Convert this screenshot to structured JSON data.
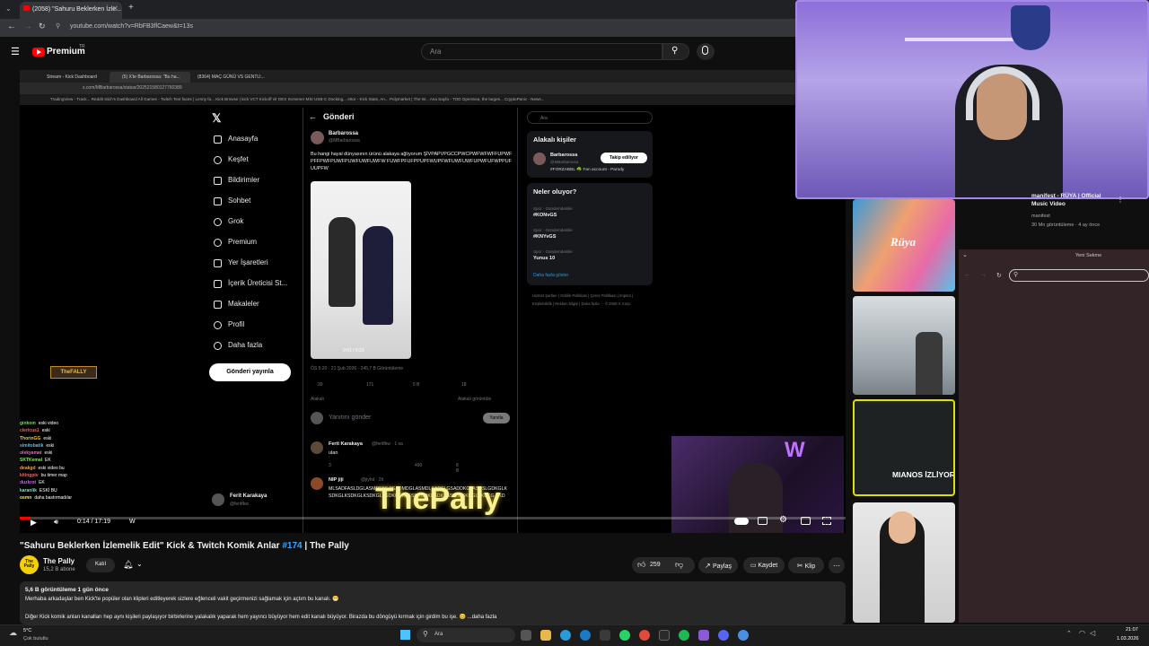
{
  "browser": {
    "tab_title": "(2058) \"Sahuru Beklerken İzle...",
    "url": "youtube.com/watch?v=RbFB3flCaew&t=13s"
  },
  "youtube": {
    "brand": "Premium",
    "region": "TR",
    "search_placeholder": "Ara"
  },
  "inner_browser": {
    "tabs": [
      "Stream - Kick Dashboard",
      "(5) X'te Barbarossa: \"Bu ha...",
      "(8364) MAÇ GÜNÜ VS GENTLI..."
    ],
    "url": "x.com/MBarbarossa/status/202521580127760389",
    "bookmarks": "TradingView - Track...   Reddit   stich's Dashboard   All Games - Twitch   Text faces | Lenny fa...   Kick   Browse | kick   VCT Kickoff   vlr   DEX Screener   MSI USB-C Docking...   ettor - Kick Stats, An...   Polymarket | The W...   Ana Sayfa - TOD   OpenSea, the larges...   CryptoPanic - News..."
  },
  "x_nav": {
    "items": [
      "Anasayfa",
      "Keşfet",
      "Bildirimler",
      "Sohbet",
      "Grok",
      "Premium",
      "Yer İşaretleri",
      "İçerik Üreticisi St...",
      "Makaleler",
      "Profil",
      "Daha fazla"
    ],
    "post_button": "Gönderi yayınla",
    "bottom_user": "Ferit Karakaya",
    "bottom_handle": "@feritfkw"
  },
  "x_post": {
    "header": "Gönderi",
    "author": "Barbarossa",
    "handle": "@MBarbarossa",
    "text": "Bu hangi hayal dünyasının ürünü alakaya ağlıyorum ŞİVPAPVPGCCPWCPWFWFWFFUPWFPFFPWFPUWFPUWFUWFUWFW FUWFPFUFPPUPFWUPFWFUWFUWFUPWFUFWPPUFUUPFW",
    "video_time": "0:01 / 0:23",
    "meta": "ÖS 5:20 · 21 Şub 2026 · 245,7 B Görüntüleme",
    "stats": [
      "39",
      "171",
      "5 B",
      "18"
    ],
    "replies_label": "Alakalı",
    "most_liked": "Alakalı görüntüle",
    "reply_placeholder": "Yanıtını gönder",
    "reply_button": "Yanıtla",
    "reply1_author": "Ferit Karakaya",
    "reply1_handle": "@feritfkw · 1 sa",
    "reply1_text": "ulan",
    "reply1_stats": [
      "3",
      "490",
      "8 B"
    ],
    "reply2_author": "NIP jiji",
    "reply2_handle": "@jiyhd · 2h",
    "reply2_text": "MLSADFASLDGLASMDFAS PSADMDGLASMDLSADSLGSADDKGLASDSLGDKGLKSDKGLKSDKGLKSDKGLKSDKGDKLGSDKGDKLGDKLGSKGLSKDGLSKDKG SKDG"
  },
  "x_right": {
    "search_placeholder": "Ara",
    "related_title": "Alakalı kişiler",
    "person_name": "Barbarossa",
    "person_handle": "@MBarbarossa",
    "follow_button": "Takip ediliyor",
    "person_bio": "#FORZABBL ☘️ Fan account - Parody",
    "trending_title": "Neler oluyor?",
    "trends": [
      {
        "cat": "Spor · Gündemdekiler",
        "name": "#KONvGS"
      },
      {
        "cat": "Spor · Gündemdekiler",
        "name": "#KNYvGS"
      },
      {
        "cat": "Spor · Gündemdekiler",
        "name": "Yunus 10"
      }
    ],
    "show_more": "Daha fazla göster",
    "footer": "Hizmet Şartları | Gizlilik Politikası | Çerez Politikası | Imprint | Erişilebilirlik | Reklam bilgisi | Daha fazla ··· © 2026 X Corp."
  },
  "chat": [
    {
      "user": "ginkom",
      "msg": "eski video"
    },
    {
      "user": "clericus1",
      "msg": "eski"
    },
    {
      "user": "ThorinGG",
      "msg": "eski"
    },
    {
      "user": "simitobatik",
      "msg": "eski"
    },
    {
      "user": "olekyamat",
      "msg": "eski"
    },
    {
      "user": "SKTKemal",
      "msg": "EK"
    },
    {
      "user": "deakgd",
      "msg": "eski video bu"
    },
    {
      "user": "kitingpiv",
      "msg": "bu timer map"
    },
    {
      "user": "duzkrot",
      "msg": "EK"
    },
    {
      "user": "karanlik",
      "msg": "ESKİ BU"
    },
    {
      "user": "osmn",
      "msg": "daha bastırmadılar"
    }
  ],
  "overlay": {
    "logo_text": "ThePally",
    "kick_badge": "TheFALLY"
  },
  "player": {
    "time": "0:14 / 17:19",
    "chapter": "W"
  },
  "video_info": {
    "title_pre": "\"Sahuru Beklerken İzlemelik Edit\" Kick & Twitch Komik Anlar ",
    "title_hash": "#174",
    "title_post": " | The Pally",
    "channel": "The Pally",
    "subs": "15,2 B abone",
    "avatar_text": "The Pally",
    "join": "Katıl",
    "likes": "259",
    "share": "Paylaş",
    "save": "Kaydet",
    "clip": "Klip",
    "views": "5,6 B görüntüleme  1 gün önce",
    "desc1": "Merhaba arkadaşlar ben Kick'te popüler olan klipleri editleyerek sizlere eğlenceli vakit geçirmenizi sağlamak için açtım bu kanalı. 😁",
    "desc2": "Diğer Kick komik anları kanalları hep aynı kişileri paylaşıyor birbirlerine yalakalık yaparak hem yayıncı büyüyor hem edit kanalı büyüyor. Birazda bu döngüyü kırmak için girdim bu işe. 😊 ...daha fazla"
  },
  "sidebar": {
    "v1_title": "manifest - RÜYA | Official Music Video",
    "v1_channel": "manifest",
    "v1_meta": "30 Mn görüntüleme · 4 ay önce",
    "thumb3_text": "MIANOS İZLİYOR"
  },
  "yeni_sekme": {
    "label": "Yeni Sekme"
  },
  "taskbar": {
    "temp": "5°C",
    "weather": "Çok bulutlu",
    "search": "Ara",
    "time": "21:07",
    "date": "1.03.2026"
  },
  "colors": {
    "yt_red": "#ff0000",
    "link_blue": "#3ea6ff",
    "logo_yellow": "#f5f09a",
    "webcam_border": "#a48ae8"
  }
}
